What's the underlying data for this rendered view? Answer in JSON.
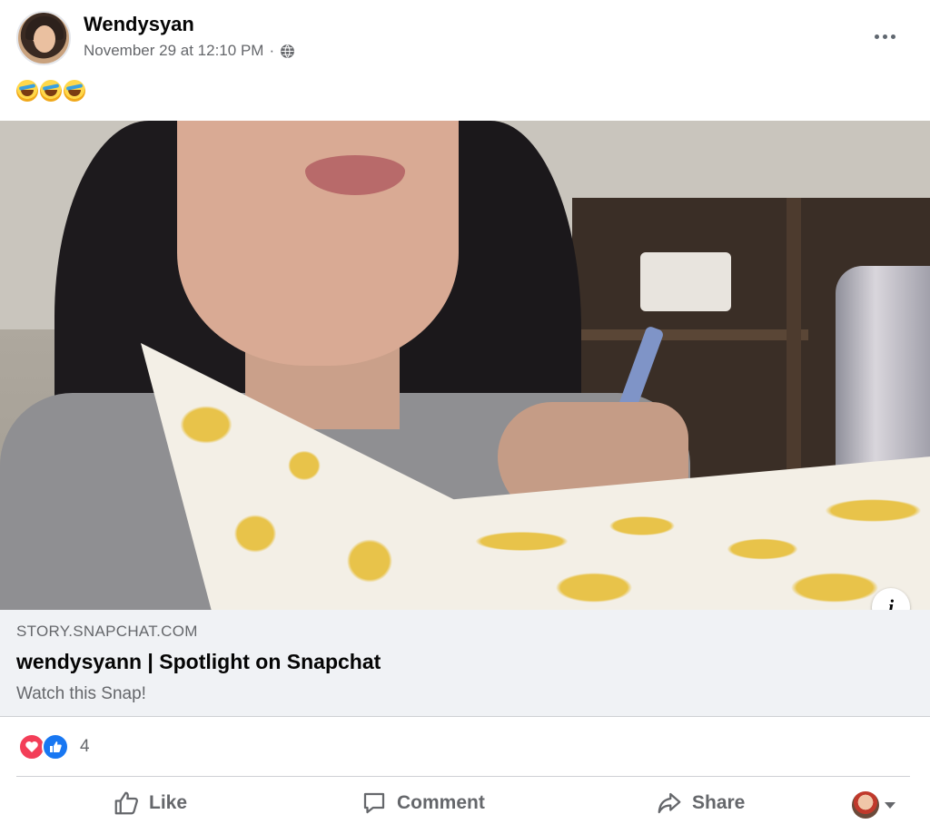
{
  "post": {
    "author": "Wendysyan",
    "timestamp": "November 29 at 12:10 PM",
    "separator": "·",
    "privacy_icon": "globe-icon",
    "more_icon": "more-options-icon",
    "text_emojis": [
      "rolling-on-floor-laughing-emoji",
      "rolling-on-floor-laughing-emoji",
      "rolling-on-floor-laughing-emoji"
    ]
  },
  "link_preview": {
    "domain": "STORY.SNAPCHAT.COM",
    "title": "wendysyann | Spotlight on Snapchat",
    "subtitle": "Watch this Snap!",
    "info_label": "i"
  },
  "reactions": {
    "types": [
      "love",
      "like"
    ],
    "count": "4"
  },
  "actions": {
    "like": "Like",
    "comment": "Comment",
    "share": "Share"
  },
  "colors": {
    "secondary_text": "#65676b",
    "link_bg": "#f0f2f5",
    "like_blue": "#1877f2",
    "love_red": "#f33e58"
  }
}
